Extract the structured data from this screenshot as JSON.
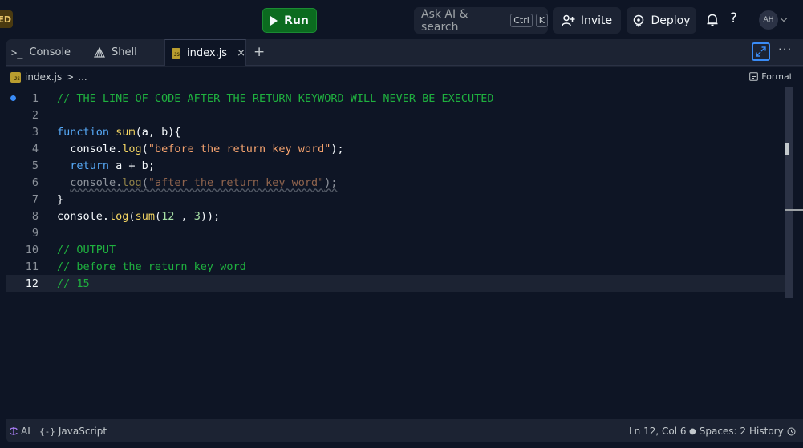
{
  "topbar": {
    "badge": "ED",
    "run_label": "Run",
    "search_label": "Ask AI & search",
    "search_kbd_1": "Ctrl",
    "search_kbd_2": "K",
    "invite_label": "Invite",
    "deploy_label": "Deploy",
    "help_label": "?",
    "avatar_initials": "AH"
  },
  "tabs": [
    {
      "label": "Console",
      "icon": "terminal-prompt-icon"
    },
    {
      "label": "Shell",
      "icon": "shell-icon"
    },
    {
      "label": "index.js",
      "icon": "js-file-icon",
      "active": true
    }
  ],
  "tab_close": "×",
  "tab_add": "+",
  "more_label": "···",
  "breadcrumb": {
    "file": "index.js",
    "sep": ">",
    "rest": "..."
  },
  "format_label": "Format",
  "js_chip": "JS",
  "editor": {
    "lines": [
      {
        "n": "1",
        "text": "// THE LINE OF CODE AFTER THE RETURN KEYWORD WILL NEVER BE EXECUTED"
      },
      {
        "n": "2",
        "text": ""
      },
      {
        "n": "3",
        "text": "function sum(a, b){"
      },
      {
        "n": "4",
        "text": "  console.log(\"before the return key word\");"
      },
      {
        "n": "5",
        "text": "  return a + b;"
      },
      {
        "n": "6",
        "text": "  console.log(\"after the return key word\");"
      },
      {
        "n": "7",
        "text": "}"
      },
      {
        "n": "8",
        "text": "console.log(sum(12 , 3));"
      },
      {
        "n": "9",
        "text": ""
      },
      {
        "n": "10",
        "text": "// OUTPUT"
      },
      {
        "n": "11",
        "text": "// before the return key word"
      },
      {
        "n": "12",
        "text": "// 15"
      }
    ],
    "current_line": 12
  },
  "status": {
    "ai_label": "AI",
    "language": "JavaScript",
    "position": "Ln 12, Col 6",
    "spaces": "Spaces: 2",
    "history": "History"
  },
  "colors": {
    "accent": "#3a8cf7",
    "run_green": "#0b6b1f",
    "comment": "#1fb13f",
    "keyword": "#56a8f5",
    "function": "#f5d663",
    "string": "#f7a46f"
  }
}
